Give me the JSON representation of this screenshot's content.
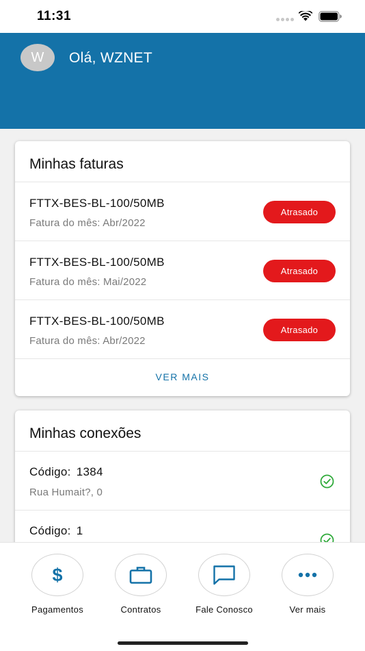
{
  "status_bar": {
    "time": "11:31",
    "icons": [
      "signal-dots-icon",
      "wifi-icon",
      "battery-icon"
    ]
  },
  "header": {
    "avatar_initial": "W",
    "greeting": "Olá, WZNET",
    "background": "#1472a8"
  },
  "invoices": {
    "title": "Minhas faturas",
    "items": [
      {
        "name": "FTTX-BES-BL-100/50MB",
        "subtitle": "Fatura do mês: Abr/2022",
        "status": "Atrasado"
      },
      {
        "name": "FTTX-BES-BL-100/50MB",
        "subtitle": "Fatura do mês: Mai/2022",
        "status": "Atrasado"
      },
      {
        "name": "FTTX-BES-BL-100/50MB",
        "subtitle": "Fatura do mês: Abr/2022",
        "status": "Atrasado"
      }
    ],
    "see_more": "VER MAIS",
    "status_color": "#e3191c"
  },
  "connections": {
    "title": "Minhas conexões",
    "items": [
      {
        "code_label": "Código:",
        "code": "1384",
        "address": "Rua Humait?, 0",
        "status_icon": "check-circle-icon"
      },
      {
        "code_label": "Código:",
        "code": "1",
        "address": "",
        "status_icon": "check-circle-icon"
      }
    ],
    "status_color": "#2faa3a"
  },
  "tab_bar": {
    "tabs": [
      {
        "label": "Pagamentos",
        "icon": "dollar-icon"
      },
      {
        "label": "Contratos",
        "icon": "briefcase-icon"
      },
      {
        "label": "Fale Conosco",
        "icon": "chat-bubble-icon"
      },
      {
        "label": "Ver mais",
        "icon": "more-dots-icon"
      }
    ]
  }
}
